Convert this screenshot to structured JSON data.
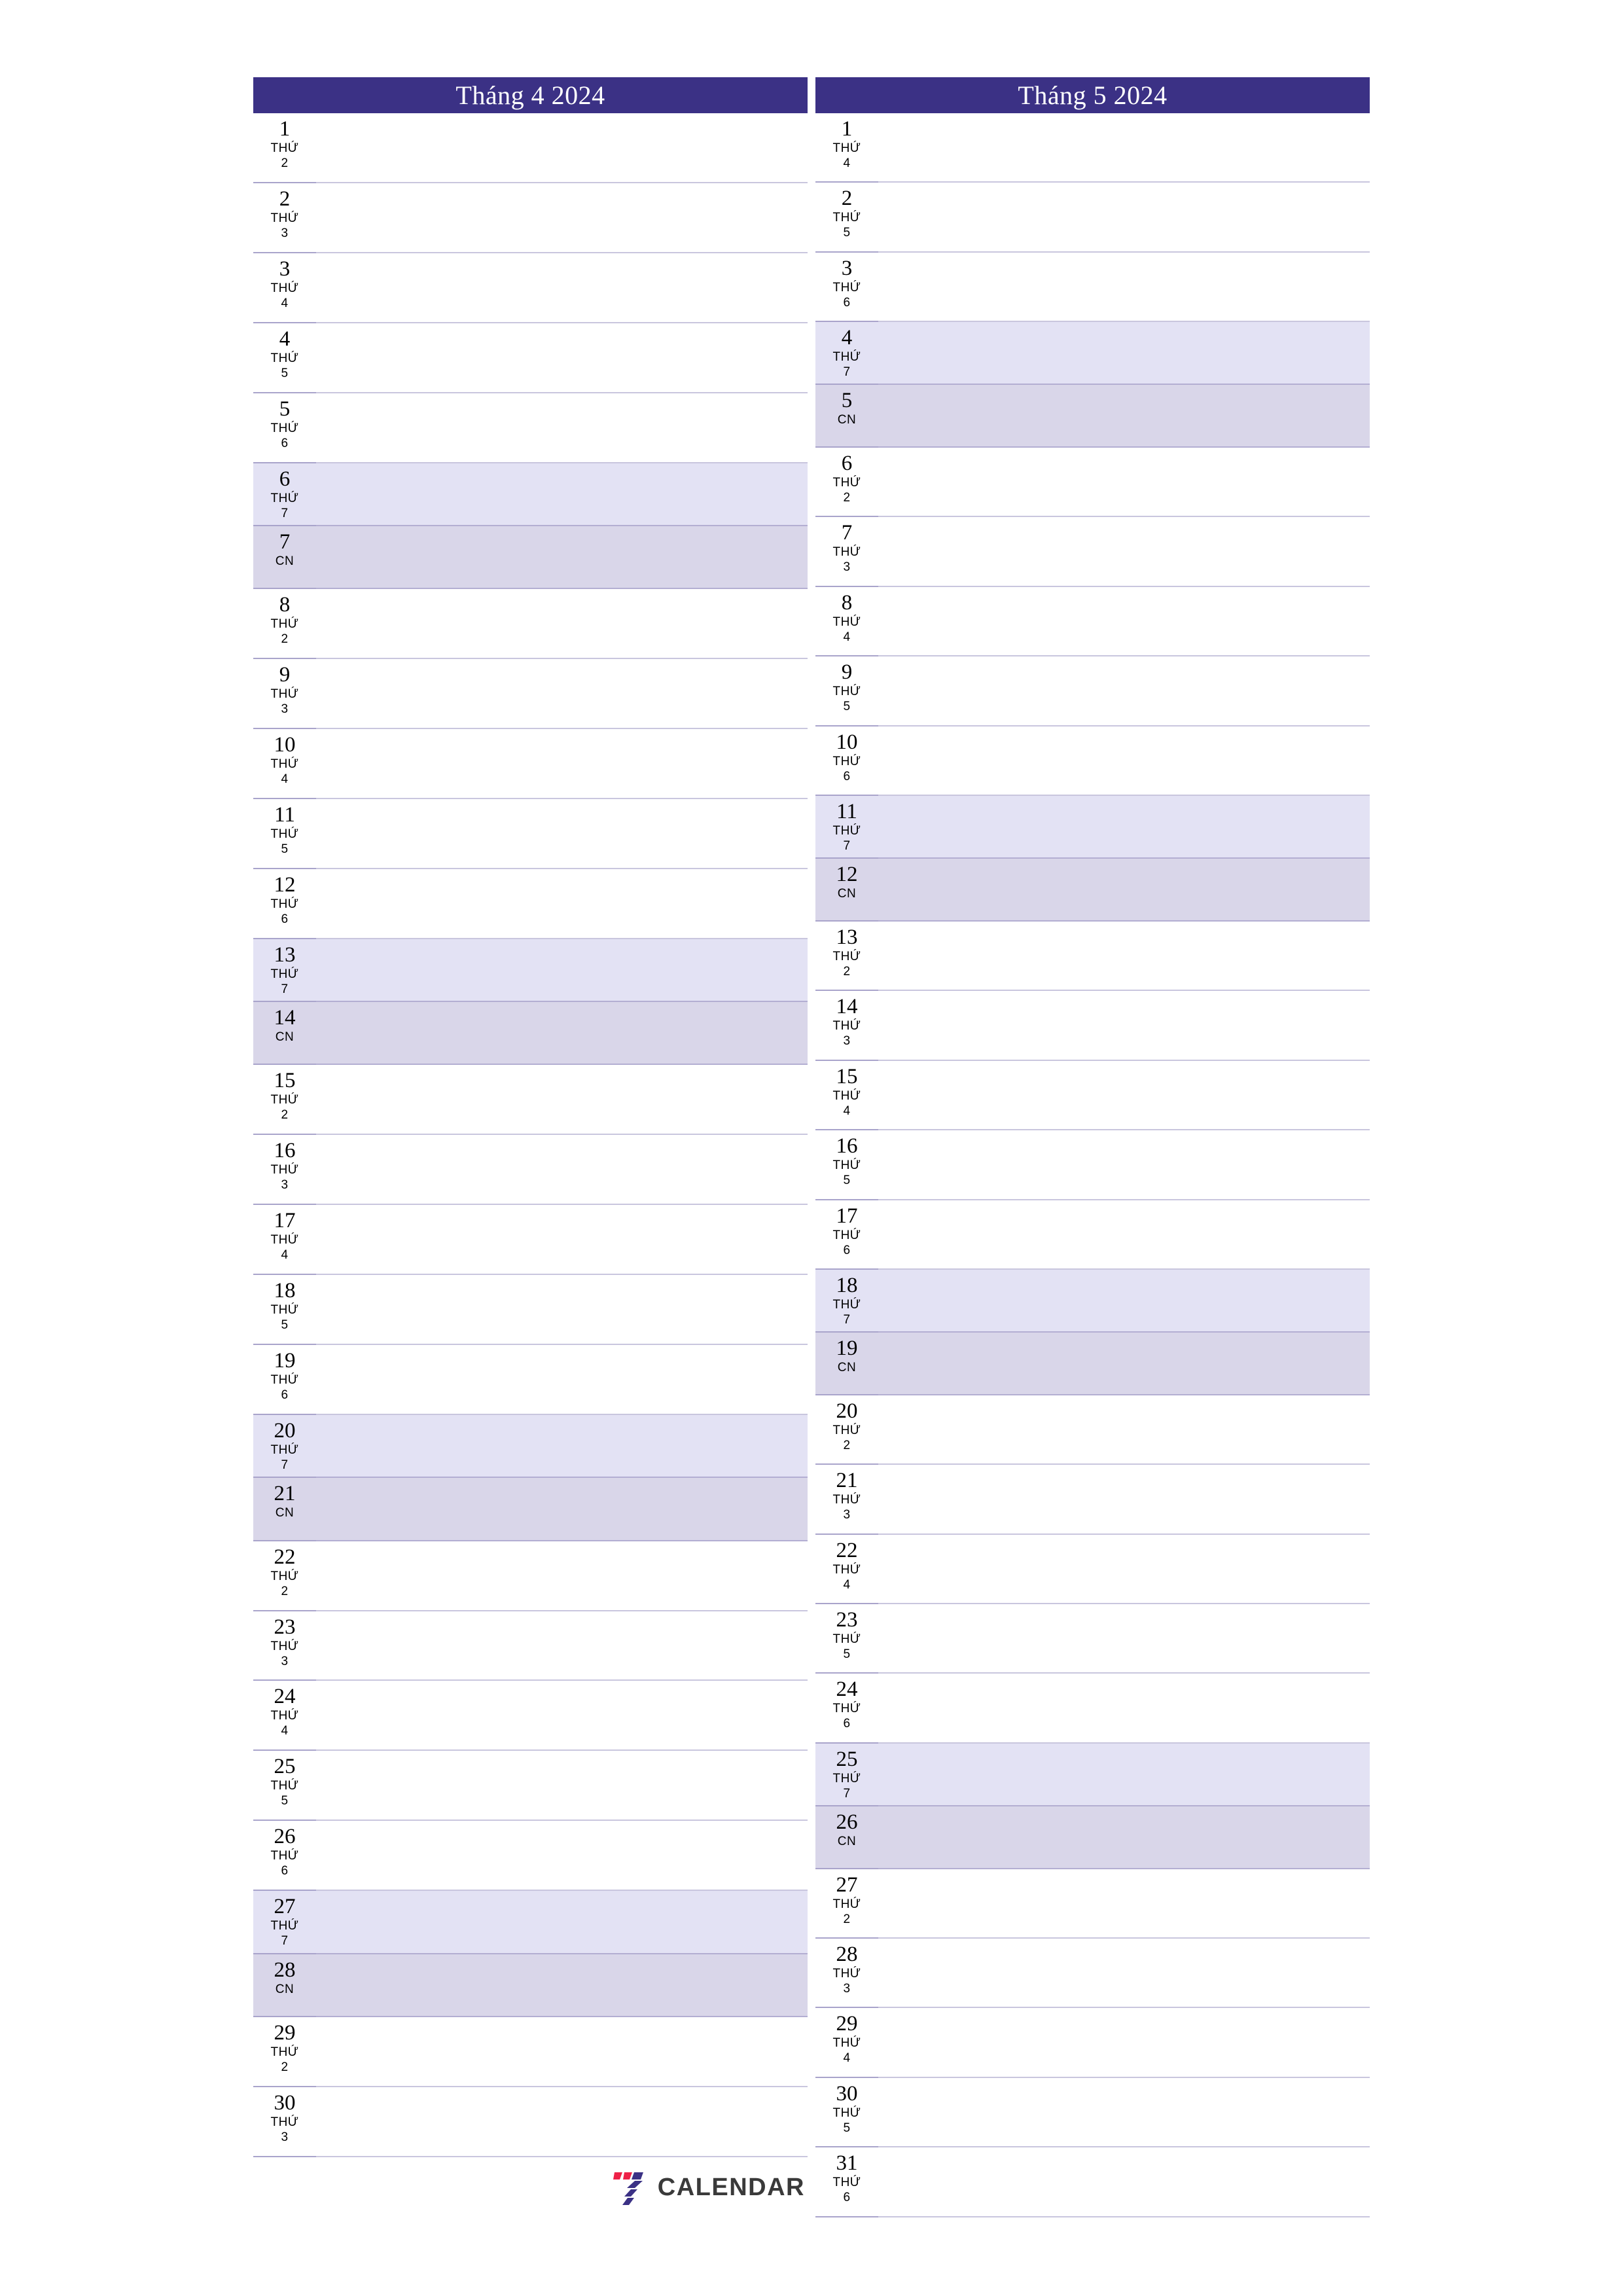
{
  "document": {
    "type": "monthly-planner",
    "orientation": "portrait",
    "language": "vi"
  },
  "theme": {
    "header_bg": "#3b3185",
    "header_text": "#ffffff",
    "saturday_bg": "#e3e2f4",
    "sunday_bg": "#d9d6e9",
    "rule_color": "#a9a4cb",
    "day_text": "#000000",
    "logo_red": "#ee2147",
    "logo_blue": "#3b3185",
    "logo_word": "#3a3a3a"
  },
  "weekday_labels": {
    "prefix": "THỨ",
    "sunday": "CN"
  },
  "brand": {
    "word": "CALENDAR",
    "mark": "seven-stripes-logo"
  },
  "months": [
    {
      "title": "Tháng 4 2024",
      "name": "Tháng 4",
      "year": "2024",
      "days": [
        {
          "day": "1",
          "dow": "THỨ",
          "w2": "2",
          "kind": "weekday"
        },
        {
          "day": "2",
          "dow": "THỨ",
          "w2": "3",
          "kind": "weekday"
        },
        {
          "day": "3",
          "dow": "THỨ",
          "w2": "4",
          "kind": "weekday"
        },
        {
          "day": "4",
          "dow": "THỨ",
          "w2": "5",
          "kind": "weekday"
        },
        {
          "day": "5",
          "dow": "THỨ",
          "w2": "6",
          "kind": "weekday"
        },
        {
          "day": "6",
          "dow": "THỨ",
          "w2": "7",
          "kind": "saturday"
        },
        {
          "day": "7",
          "dow": "CN",
          "w2": "",
          "kind": "sunday"
        },
        {
          "day": "8",
          "dow": "THỨ",
          "w2": "2",
          "kind": "weekday"
        },
        {
          "day": "9",
          "dow": "THỨ",
          "w2": "3",
          "kind": "weekday"
        },
        {
          "day": "10",
          "dow": "THỨ",
          "w2": "4",
          "kind": "weekday"
        },
        {
          "day": "11",
          "dow": "THỨ",
          "w2": "5",
          "kind": "weekday"
        },
        {
          "day": "12",
          "dow": "THỨ",
          "w2": "6",
          "kind": "weekday"
        },
        {
          "day": "13",
          "dow": "THỨ",
          "w2": "7",
          "kind": "saturday"
        },
        {
          "day": "14",
          "dow": "CN",
          "w2": "",
          "kind": "sunday"
        },
        {
          "day": "15",
          "dow": "THỨ",
          "w2": "2",
          "kind": "weekday"
        },
        {
          "day": "16",
          "dow": "THỨ",
          "w2": "3",
          "kind": "weekday"
        },
        {
          "day": "17",
          "dow": "THỨ",
          "w2": "4",
          "kind": "weekday"
        },
        {
          "day": "18",
          "dow": "THỨ",
          "w2": "5",
          "kind": "weekday"
        },
        {
          "day": "19",
          "dow": "THỨ",
          "w2": "6",
          "kind": "weekday"
        },
        {
          "day": "20",
          "dow": "THỨ",
          "w2": "7",
          "kind": "saturday"
        },
        {
          "day": "21",
          "dow": "CN",
          "w2": "",
          "kind": "sunday"
        },
        {
          "day": "22",
          "dow": "THỨ",
          "w2": "2",
          "kind": "weekday"
        },
        {
          "day": "23",
          "dow": "THỨ",
          "w2": "3",
          "kind": "weekday"
        },
        {
          "day": "24",
          "dow": "THỨ",
          "w2": "4",
          "kind": "weekday"
        },
        {
          "day": "25",
          "dow": "THỨ",
          "w2": "5",
          "kind": "weekday"
        },
        {
          "day": "26",
          "dow": "THỨ",
          "w2": "6",
          "kind": "weekday"
        },
        {
          "day": "27",
          "dow": "THỨ",
          "w2": "7",
          "kind": "saturday"
        },
        {
          "day": "28",
          "dow": "CN",
          "w2": "",
          "kind": "sunday"
        },
        {
          "day": "29",
          "dow": "THỨ",
          "w2": "2",
          "kind": "weekday"
        },
        {
          "day": "30",
          "dow": "THỨ",
          "w2": "3",
          "kind": "weekday"
        }
      ]
    },
    {
      "title": "Tháng 5 2024",
      "name": "Tháng 5",
      "year": "2024",
      "days": [
        {
          "day": "1",
          "dow": "THỨ",
          "w2": "4",
          "kind": "weekday"
        },
        {
          "day": "2",
          "dow": "THỨ",
          "w2": "5",
          "kind": "weekday"
        },
        {
          "day": "3",
          "dow": "THỨ",
          "w2": "6",
          "kind": "weekday"
        },
        {
          "day": "4",
          "dow": "THỨ",
          "w2": "7",
          "kind": "saturday"
        },
        {
          "day": "5",
          "dow": "CN",
          "w2": "",
          "kind": "sunday"
        },
        {
          "day": "6",
          "dow": "THỨ",
          "w2": "2",
          "kind": "weekday"
        },
        {
          "day": "7",
          "dow": "THỨ",
          "w2": "3",
          "kind": "weekday"
        },
        {
          "day": "8",
          "dow": "THỨ",
          "w2": "4",
          "kind": "weekday"
        },
        {
          "day": "9",
          "dow": "THỨ",
          "w2": "5",
          "kind": "weekday"
        },
        {
          "day": "10",
          "dow": "THỨ",
          "w2": "6",
          "kind": "weekday"
        },
        {
          "day": "11",
          "dow": "THỨ",
          "w2": "7",
          "kind": "saturday"
        },
        {
          "day": "12",
          "dow": "CN",
          "w2": "",
          "kind": "sunday"
        },
        {
          "day": "13",
          "dow": "THỨ",
          "w2": "2",
          "kind": "weekday"
        },
        {
          "day": "14",
          "dow": "THỨ",
          "w2": "3",
          "kind": "weekday"
        },
        {
          "day": "15",
          "dow": "THỨ",
          "w2": "4",
          "kind": "weekday"
        },
        {
          "day": "16",
          "dow": "THỨ",
          "w2": "5",
          "kind": "weekday"
        },
        {
          "day": "17",
          "dow": "THỨ",
          "w2": "6",
          "kind": "weekday"
        },
        {
          "day": "18",
          "dow": "THỨ",
          "w2": "7",
          "kind": "saturday"
        },
        {
          "day": "19",
          "dow": "CN",
          "w2": "",
          "kind": "sunday"
        },
        {
          "day": "20",
          "dow": "THỨ",
          "w2": "2",
          "kind": "weekday"
        },
        {
          "day": "21",
          "dow": "THỨ",
          "w2": "3",
          "kind": "weekday"
        },
        {
          "day": "22",
          "dow": "THỨ",
          "w2": "4",
          "kind": "weekday"
        },
        {
          "day": "23",
          "dow": "THỨ",
          "w2": "5",
          "kind": "weekday"
        },
        {
          "day": "24",
          "dow": "THỨ",
          "w2": "6",
          "kind": "weekday"
        },
        {
          "day": "25",
          "dow": "THỨ",
          "w2": "7",
          "kind": "saturday"
        },
        {
          "day": "26",
          "dow": "CN",
          "w2": "",
          "kind": "sunday"
        },
        {
          "day": "27",
          "dow": "THỨ",
          "w2": "2",
          "kind": "weekday"
        },
        {
          "day": "28",
          "dow": "THỨ",
          "w2": "3",
          "kind": "weekday"
        },
        {
          "day": "29",
          "dow": "THỨ",
          "w2": "4",
          "kind": "weekday"
        },
        {
          "day": "30",
          "dow": "THỨ",
          "w2": "5",
          "kind": "weekday"
        },
        {
          "day": "31",
          "dow": "THỨ",
          "w2": "6",
          "kind": "weekday"
        }
      ]
    }
  ]
}
